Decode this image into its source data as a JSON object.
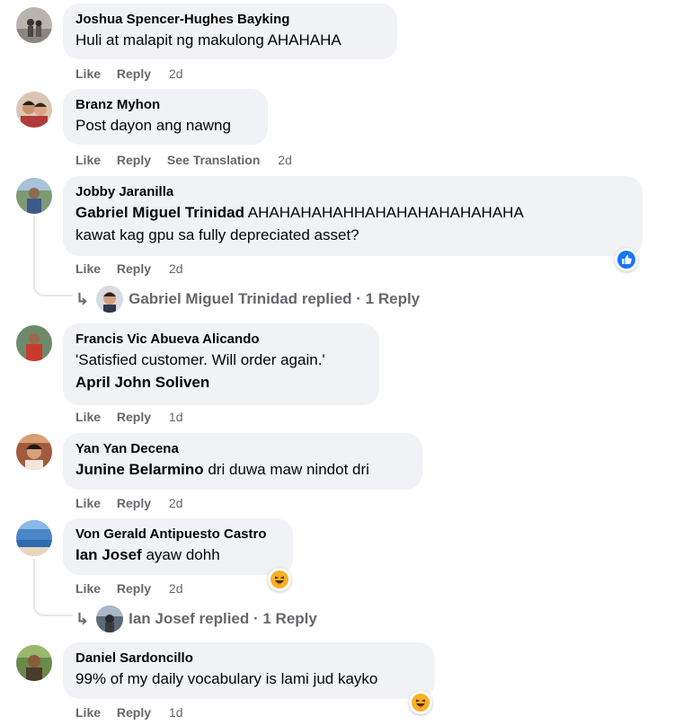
{
  "comments": [
    {
      "author": "Joshua Spencer-Hughes Bayking",
      "text": "Huli at malapit ng makulong AHAHAHA",
      "actions": {
        "like": "Like",
        "reply": "Reply",
        "time": "2d"
      }
    },
    {
      "author": "Branz Myhon",
      "text": "Post dayon ang nawng",
      "actions": {
        "like": "Like",
        "reply": "Reply",
        "translate": "See Translation",
        "time": "2d"
      }
    },
    {
      "author": "Jobby Jaranilla",
      "mention": "Gabriel Miguel Trinidad",
      "text": "AHAHAHAHAHHAHAHAHAHAHAHAHA",
      "text2": "kawat kag gpu sa fully depreciated asset?",
      "actions": {
        "like": "Like",
        "reply": "Reply",
        "time": "2d"
      },
      "reaction": "like",
      "replies": {
        "author": "Gabriel Miguel Trinidad",
        "suffix": "replied · 1 Reply"
      }
    },
    {
      "author": "Francis Vic Abueva Alicando",
      "text": "'Satisfied customer. Will order again.'",
      "mention": "April John Soliven",
      "actions": {
        "like": "Like",
        "reply": "Reply",
        "time": "1d"
      }
    },
    {
      "author": "Yan Yan Decena",
      "mention": "Junine Belarmino",
      "text": "dri duwa maw nindot dri",
      "actions": {
        "like": "Like",
        "reply": "Reply",
        "time": "2d"
      }
    },
    {
      "author": "Von Gerald Antipuesto Castro",
      "mention": "Ian Josef",
      "text": "ayaw dohh",
      "actions": {
        "like": "Like",
        "reply": "Reply",
        "time": "2d"
      },
      "reaction": "haha",
      "replies": {
        "author": "Ian Josef",
        "suffix": "replied · 1 Reply"
      }
    },
    {
      "author": "Daniel Sardoncillo",
      "text": "99% of my daily vocabulary is lami jud kayko",
      "actions": {
        "like": "Like",
        "reply": "Reply",
        "time": "1d"
      },
      "reaction": "haha"
    }
  ],
  "colors": {
    "bubble": "#f0f2f5",
    "meta": "#65676b",
    "like_blue": "#1877f2",
    "haha_yellow": "#f7b125"
  },
  "icons": [
    "reply-arrow-icon",
    "like-reaction-icon",
    "haha-reaction-icon"
  ]
}
